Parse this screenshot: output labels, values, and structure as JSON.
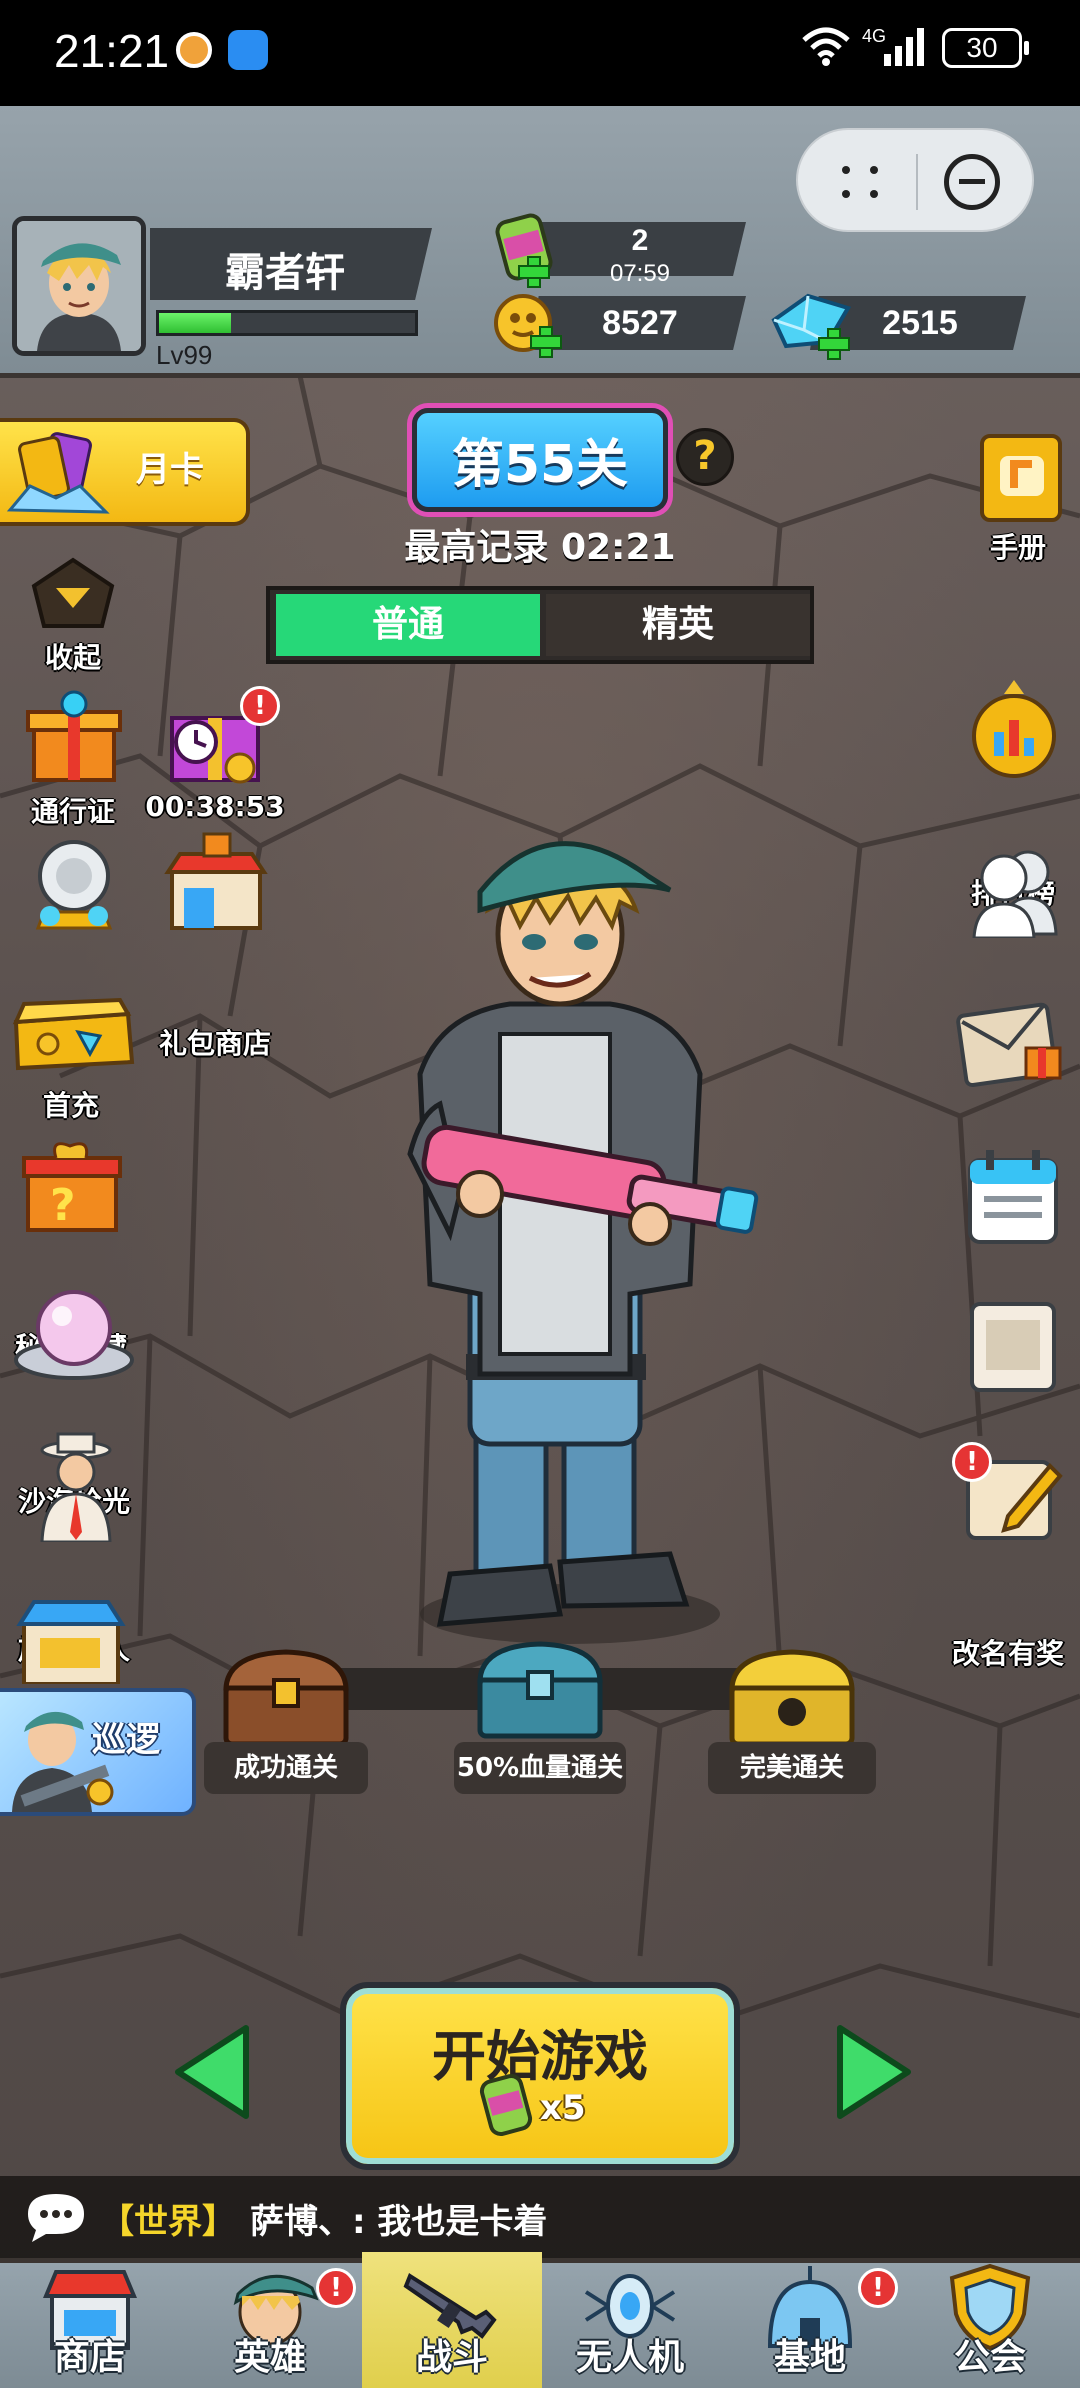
{
  "status_bar": {
    "time": "21:21",
    "network": "4G",
    "battery": "30"
  },
  "player": {
    "name": "霸者轩",
    "level": "Lv99",
    "xp_fraction": 0.28
  },
  "resources": {
    "energy": {
      "value": "2",
      "timer": "07:59"
    },
    "gold": {
      "value": "8527"
    },
    "diamond": {
      "value": "2515"
    }
  },
  "stage": {
    "title": "第55关",
    "help": "?",
    "record": "最高记录 02:21"
  },
  "mode_tabs": {
    "normal": "普通",
    "elite": "精英",
    "active": "normal"
  },
  "left_menu": {
    "month_card": "月卡",
    "collapse": "收起",
    "battle_pass": "通行证",
    "gift_timer": "00:38:53",
    "events": "活动",
    "gift_shop": "礼包商店",
    "first_recharge": "首充",
    "treasure": "秘宝潜藏",
    "sand_sea": "沙海拾光",
    "travel_merchant": "旅行商人",
    "patrol": "巡逻"
  },
  "right_menu": {
    "manual": "手册",
    "ranking": "排行榜",
    "friends": "好友",
    "mail": "邮件",
    "tasks": "任务",
    "codex": "图鉴",
    "rename_reward": "改名有奖"
  },
  "chests": {
    "clear": "成功通关",
    "half_hp": "50%血量通关",
    "perfect": "完美通关"
  },
  "start": {
    "label": "开始游戏",
    "cost": "x5"
  },
  "chat": {
    "channel": "【世界】",
    "message": "萨博、: 我也是卡着"
  },
  "bottom_nav": {
    "shop": "商店",
    "heroes": "英雄",
    "battle": "战斗",
    "drone": "无人机",
    "base": "基地",
    "guild": "公会",
    "active": "battle"
  },
  "badge_mark": "!",
  "colors": {
    "accent_green": "#26d878",
    "start_yellow": "#f6c414",
    "stage_blue": "#1e9cf0",
    "chat_channel": "#f5d52a",
    "notify_red": "#e53434"
  }
}
